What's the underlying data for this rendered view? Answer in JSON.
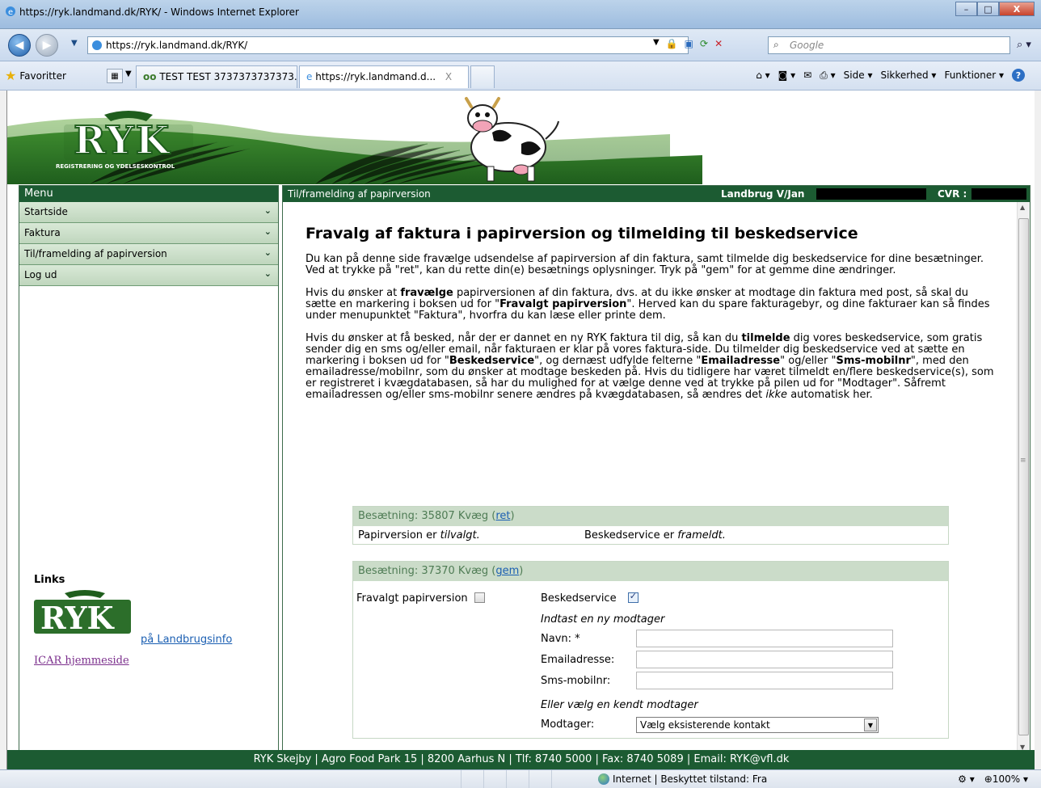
{
  "window": {
    "title": "https://ryk.landmand.dk/RYK/ - Windows Internet Explorer",
    "minimize": "–",
    "maximize": "□",
    "close": "X"
  },
  "addressbar": {
    "url": "https://ryk.landmand.dk/RYK/",
    "search_placeholder": "Google"
  },
  "tabbar": {
    "favorites_label": "Favoritter",
    "tabs": [
      {
        "label": "TEST TEST 3737373737373..."
      },
      {
        "label": "https://ryk.landmand.d...",
        "close": "X"
      }
    ],
    "commands": {
      "side": "Side ▾",
      "sikkerhed": "Sikkerhed ▾",
      "funktioner": "Funktioner ▾",
      "help": "?"
    }
  },
  "banner": {
    "logo_text": "RYK",
    "logo_subtitle": "REGISTRERING OG YDELSESKONTROL"
  },
  "menu": {
    "header": "Menu",
    "items": [
      {
        "label": "Startside"
      },
      {
        "label": "Faktura"
      },
      {
        "label": "Til/framelding af papirversion"
      },
      {
        "label": "Log ud"
      }
    ]
  },
  "links": {
    "header": "Links",
    "landbrugsinfo": "på Landbrugsinfo",
    "icar": "ICAR hjemmeside"
  },
  "content": {
    "header_title": "Til/framelding af papirversion",
    "farm_label": "Landbrug V/Jan",
    "cvr_label": "CVR :",
    "heading": "Fravalg af faktura i papirversion og tilmelding til beskedservice",
    "p1": "Du kan på denne side fravælge udsendelse af papirversion af din faktura, samt tilmelde dig beskedservice for dine besætninger. Ved at trykke på \"ret\", kan du rette din(e) besætnings oplysninger. Tryk på \"gem\" for at gemme dine ændringer.",
    "p2_a": "Hvis du ønsker at ",
    "p2_b": "fravælge",
    "p2_c": " papirversionen af din faktura, dvs. at du ikke ønsker at modtage din faktura med post, så skal du sætte en markering i boksen ud for \"",
    "p2_d": "Fravalgt papirversion",
    "p2_e": "\". Herved kan du spare fakturagebyr, og dine fakturaer kan så findes under menupunktet \"Faktura\", hvorfra du kan læse eller printe dem.",
    "p3_a": "Hvis du ønsker at få besked, når der er dannet en ny RYK faktura til dig, så kan du ",
    "p3_b": "tilmelde",
    "p3_c": " dig vores beskedservice, som gratis sender dig en sms og/eller email, når fakturaen er klar på vores faktura-side. Du tilmelder dig beskedservice ved at sætte en markering i boksen ud for \"",
    "p3_d": "Beskedservice",
    "p3_e": "\", og dernæst udfylde felterne \"",
    "p3_f": "Emailadresse",
    "p3_g": "\" og/eller \"",
    "p3_h": "Sms-mobilnr",
    "p3_i": "\", med den emailadresse/mobilnr, som du ønsker at modtage beskeden på. Hvis du tidligere har været tilmeldt en/flere beskedservice(s), som er registreret i kvægdatabasen, så har du mulighed for at vælge denne ved at trykke på pilen ud for \"Modtager\". Såfremt emailadressen og/eller sms-mobilnr senere ændres på kvægdatabasen, så ændres det ",
    "p3_j": "ikke",
    "p3_k": " automatisk her."
  },
  "herd1": {
    "title": "Besætning: 35807 Kvæg (",
    "link": "ret",
    "title_end": ")",
    "paper_prefix": "Papirversion er ",
    "paper_status": "tilvalgt.",
    "service_prefix": "Beskedservice er ",
    "service_status": "frameldt."
  },
  "herd2": {
    "title": "Besætning: 37370 Kvæg (",
    "link": "gem",
    "title_end": ")",
    "fravalgt_label": "Fravalgt papirversion",
    "fravalgt_checked": false,
    "beskedservice_label": "Beskedservice",
    "beskedservice_checked": true,
    "new_recipient_label": "Indtast en ny modtager",
    "navn_label": "Navn: *",
    "navn_value": "",
    "email_label": "Emailadresse:",
    "email_value": "",
    "sms_label": "Sms-mobilnr:",
    "sms_value": "",
    "known_recipient_label": "Eller vælg en kendt modtager",
    "modtager_label": "Modtager:",
    "modtager_selected": "Vælg eksisterende kontakt"
  },
  "footer": {
    "text": "RYK Skejby | Agro Food Park 15 | 8200 Aarhus N | Tlf: 8740 5000 | Fax: 8740 5089 | Email: RYK@vfl.dk"
  },
  "statusbar": {
    "zone": "Internet | Beskyttet tilstand: Fra",
    "zoom": "100%"
  }
}
